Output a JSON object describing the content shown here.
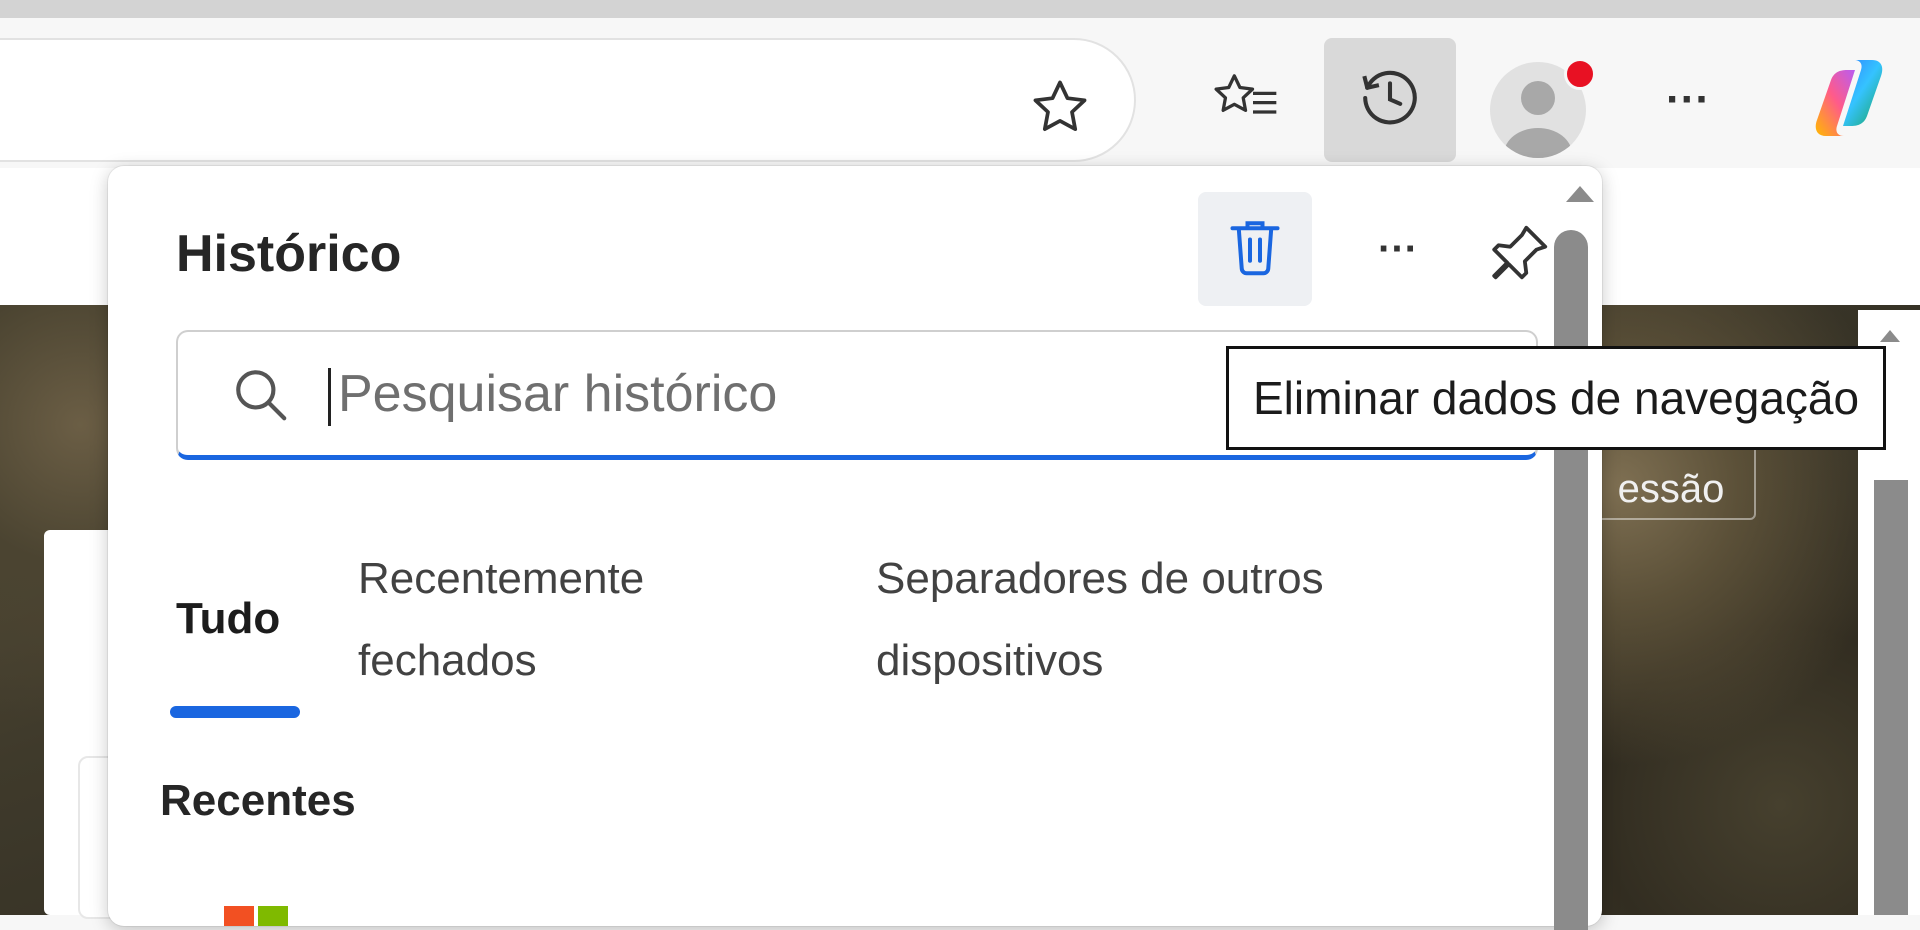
{
  "toolbar": {
    "favorite_icon": "star-outline-icon",
    "favorites_icon": "favorites-list-icon",
    "history_icon": "history-clock-icon",
    "more_icon": "more-horizontal-icon",
    "copilot_icon": "copilot-icon",
    "more_label": "···"
  },
  "page": {
    "login_button_partial": "essão"
  },
  "history_panel": {
    "title": "Histórico",
    "more_label": "···",
    "search_placeholder": "Pesquisar histórico",
    "tabs": [
      {
        "label": "Tudo",
        "active": true
      },
      {
        "label": "Recentemente fechados",
        "active": false
      },
      {
        "label": "Separadores de outros dispositivos",
        "active": false
      }
    ],
    "section_label": "Recentes",
    "accent_color": "#1a66e0"
  },
  "tooltip": {
    "text": "Eliminar dados de navegação"
  }
}
